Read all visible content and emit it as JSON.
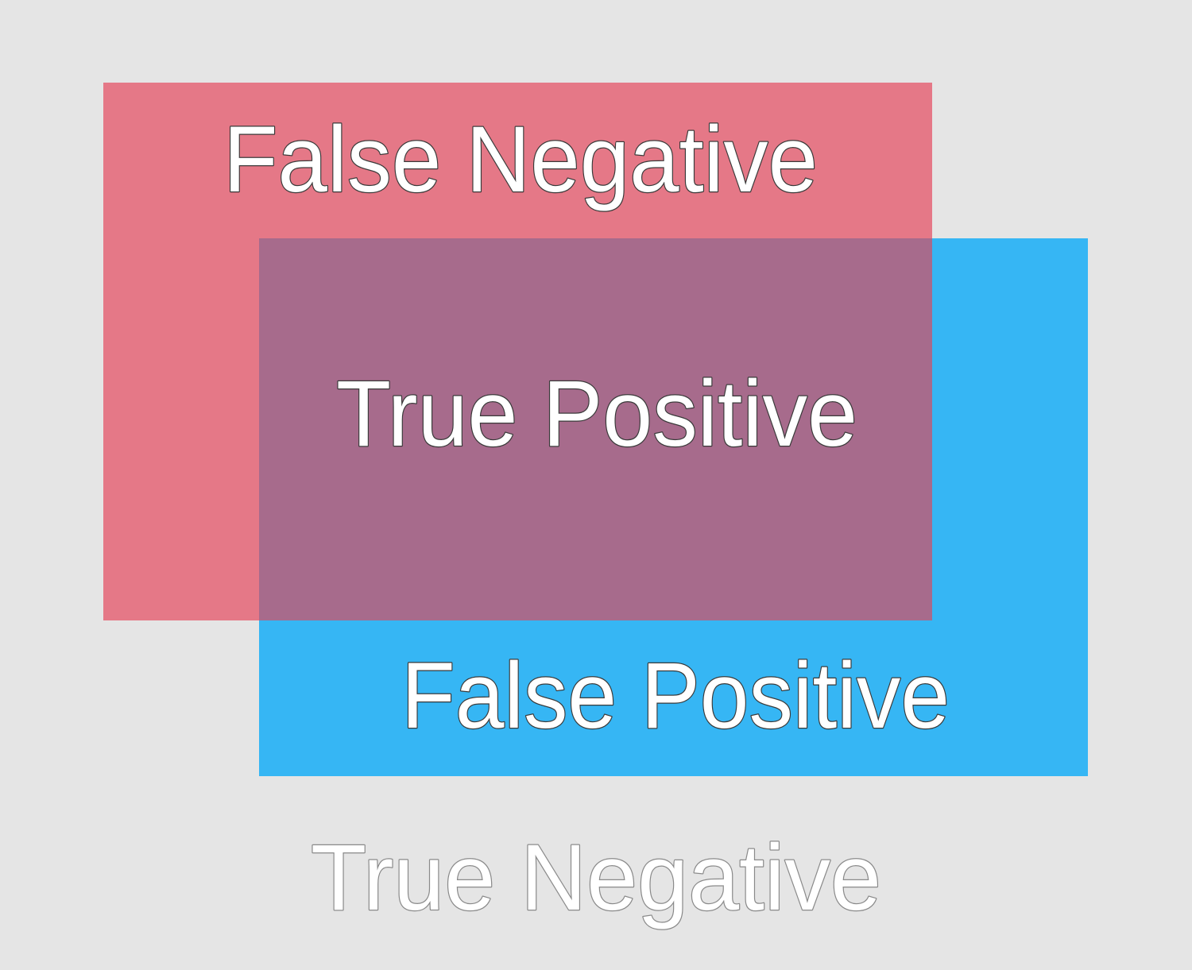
{
  "diagram": {
    "regions": {
      "actual": {
        "color": "#e57887"
      },
      "predicted": {
        "color": "#36b6f4"
      },
      "overlap": {
        "color": "#a76b8c"
      }
    },
    "labels": {
      "false_negative": "False Negative",
      "true_positive": "True Positive",
      "false_positive": "False Positive",
      "true_negative": "True Negative"
    }
  }
}
